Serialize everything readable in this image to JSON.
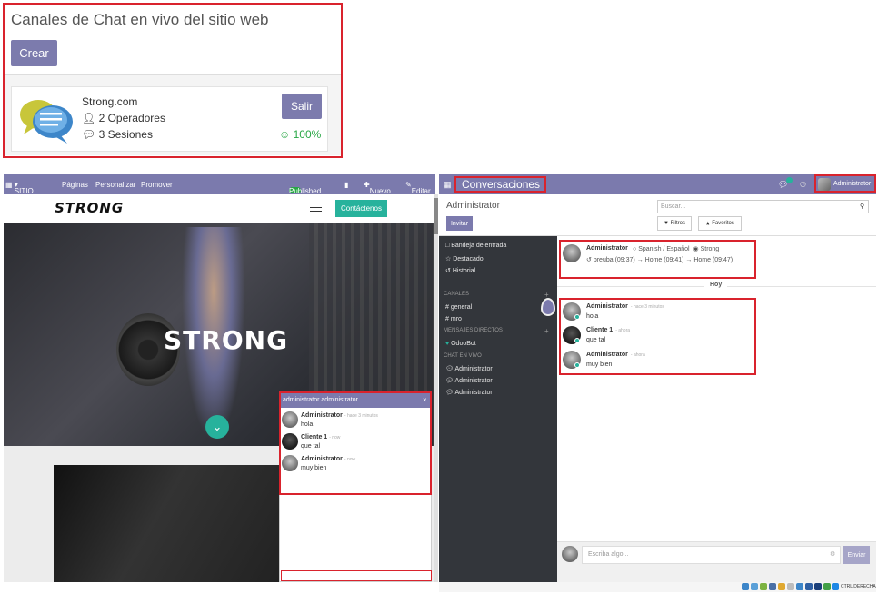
{
  "channels_panel": {
    "title": "Canales de Chat en vivo del sitio web",
    "create_label": "Crear",
    "channel": {
      "name": "Strong.com",
      "operators": "2 Operadores",
      "sessions": "3 Sesiones",
      "leave_label": "Salir",
      "rating": "100%"
    }
  },
  "website": {
    "nav": {
      "app_menu": "SITIO WEB",
      "items": [
        "Páginas",
        "Personalizar",
        "Promover"
      ],
      "published": "Published",
      "new_label": "Nuevo",
      "edit_label": "Editar"
    },
    "logo": "STRONG",
    "contact_label": "Contáctenos",
    "hero_text": "STRONG"
  },
  "livechat_window": {
    "title": "administrator administrator",
    "close": "×",
    "messages": [
      {
        "author": "Administrator",
        "time": "- hace 3 minutos",
        "text": "hola"
      },
      {
        "author": "Cliente 1",
        "time": "- now",
        "text": "que tal"
      },
      {
        "author": "Administrator",
        "time": "- now",
        "text": "muy bien"
      }
    ]
  },
  "discuss": {
    "topbar_title": "Conversaciones",
    "user_name": "Administrator",
    "breadcrumb": "Administrator",
    "invite_label": "Invitar",
    "search_placeholder": "Buscar...",
    "filters_label": "Filtros",
    "favorites_label": "Favoritos",
    "sidebar": {
      "inbox": "Bandeja de entrada",
      "starred": "Destacado",
      "history": "Historial",
      "channels_header": "CANALES",
      "channels": [
        "general",
        "mro"
      ],
      "direct_header": "MENSAJES DIRECTOS",
      "direct": [
        "OdooBot"
      ],
      "livechat_header": "CHAT EN VIVO",
      "livechat": [
        "Administrator",
        "Administrator",
        "Administrator"
      ]
    },
    "thread": {
      "header_author": "Administrator",
      "language": "Spanish / Español",
      "website": "Strong",
      "route": "preuba (09:37) → Home (09:41) → Home (09:47)",
      "day_separator": "Hoy",
      "messages": [
        {
          "author": "Administrator",
          "time": "- hace 3 minutos",
          "text": "hola"
        },
        {
          "author": "Cliente 1",
          "time": "- ahora",
          "text": "que tal"
        },
        {
          "author": "Administrator",
          "time": "- ahora",
          "text": "muy bien"
        }
      ]
    },
    "composer_placeholder": "Escriba algo...",
    "send_label": "Enviar"
  },
  "taskbar": {
    "label": "CTRL DERECHA"
  },
  "colors": {
    "brand_purple": "#7b7aad",
    "highlight_red": "#d9232d",
    "teal": "#27b29c",
    "sidebar_dark": "#33363b"
  }
}
